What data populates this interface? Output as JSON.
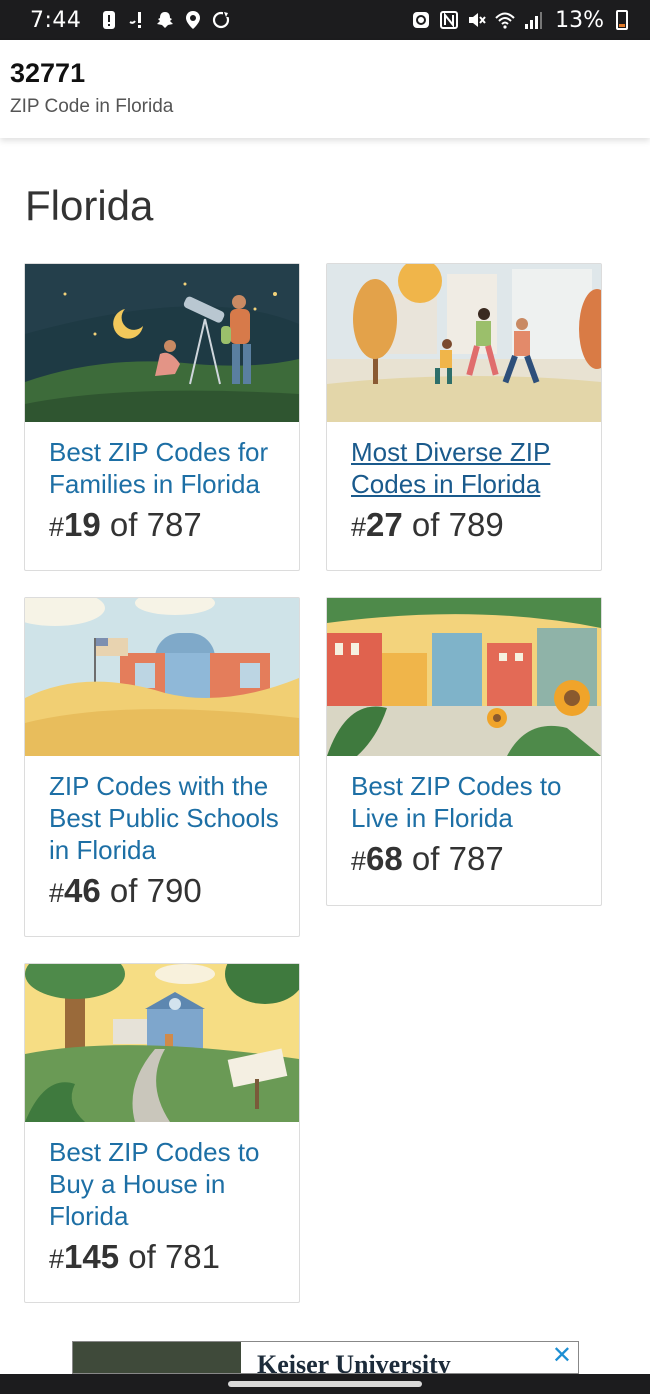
{
  "status_bar": {
    "time": "7:44",
    "battery_percent": "13%",
    "left_icons": [
      "alert-icon",
      "signal-bang-icon",
      "snapchat-icon",
      "location-icon",
      "sync-icon"
    ],
    "right_icons": [
      "recycle-icon",
      "nfc-icon",
      "mute-icon",
      "wifi-icon",
      "cell-signal-icon",
      "battery-icon"
    ]
  },
  "header": {
    "title": "32771",
    "subtitle": "ZIP Code in Florida"
  },
  "section": {
    "title": "Florida"
  },
  "cards": [
    {
      "title": "Best ZIP Codes for Families in Florida",
      "hash": "#",
      "rank": "19",
      "of_text": " of 787",
      "image": "family-stargazing-illustration"
    },
    {
      "title": "Most Diverse ZIP Codes in Florida",
      "hash": "#",
      "rank": "27",
      "of_text": " of 789",
      "image": "people-walking-city-illustration"
    },
    {
      "title": "ZIP Codes with the Best Public Schools in Florida",
      "hash": "#",
      "rank": "46",
      "of_text": " of 790",
      "image": "school-building-illustration"
    },
    {
      "title": "Best ZIP Codes to Live in Florida",
      "hash": "#",
      "rank": "68",
      "of_text": " of 787",
      "image": "town-sunflowers-illustration"
    },
    {
      "title": "Best ZIP Codes to Buy a House in Florida",
      "hash": "#",
      "rank": "145",
      "of_text": " of 781",
      "image": "house-sold-sign-illustration"
    }
  ],
  "ad": {
    "text": "Keiser University",
    "close_label": "✕"
  },
  "colors": {
    "link": "#1d6fa5",
    "status_bar": "#1c1c1e"
  }
}
